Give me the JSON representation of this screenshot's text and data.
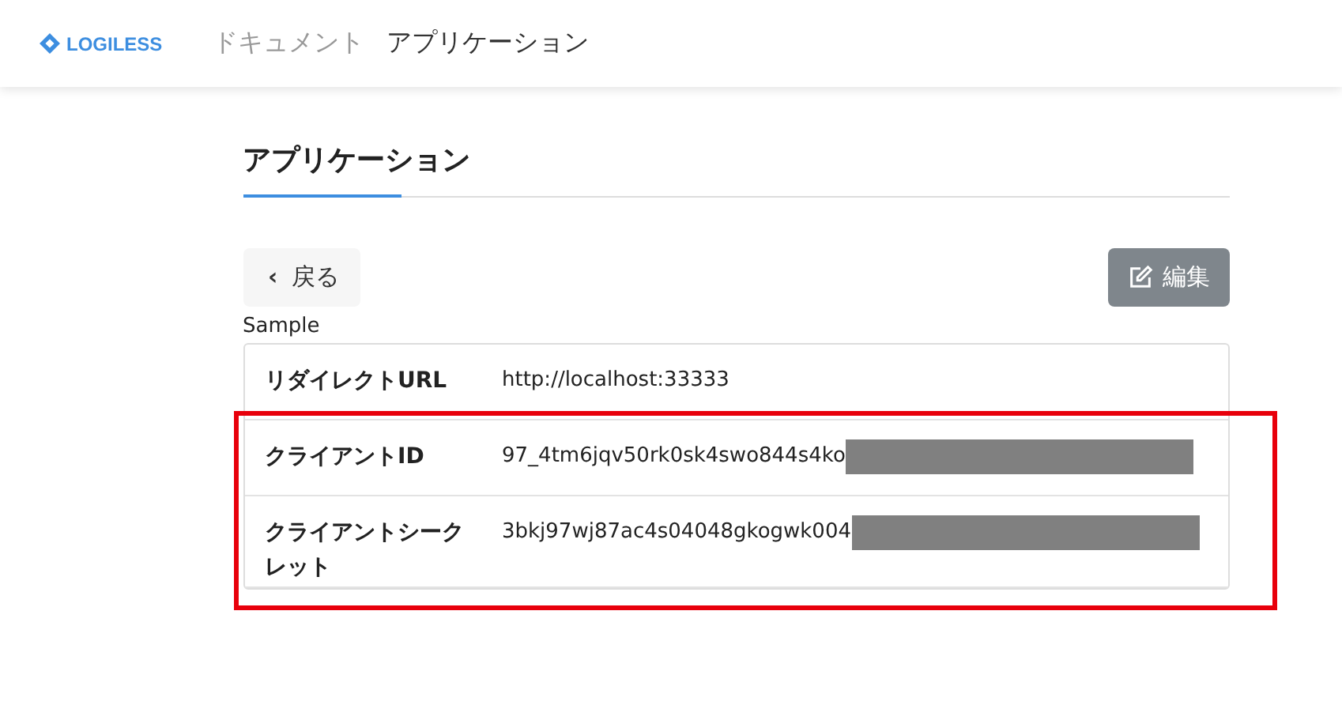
{
  "header": {
    "logo": "LOGILESS",
    "nav": [
      {
        "label": "ドキュメント",
        "selected": false
      },
      {
        "label": "アプリケーション",
        "selected": true
      }
    ]
  },
  "tabs": [
    {
      "label": "アプリケーション",
      "selected": true
    }
  ],
  "back_button": {
    "icon": "‹",
    "label": "戻る"
  },
  "edit_button": {
    "label": "編集"
  },
  "app_name": "Sample",
  "rows": [
    {
      "label": "リダイレクトURL",
      "value": "http://localhost:33333",
      "redacted": false,
      "highlighted": false
    },
    {
      "label": "クライアントID",
      "value": "97_4tm6jqv50rk0sk4swo844s4ko",
      "redacted": true,
      "highlighted": true
    },
    {
      "label": "クライアントシークレット",
      "value": "3bkj97wj87ac4s04048gkogwk004",
      "redacted": true,
      "highlighted": true
    }
  ]
}
